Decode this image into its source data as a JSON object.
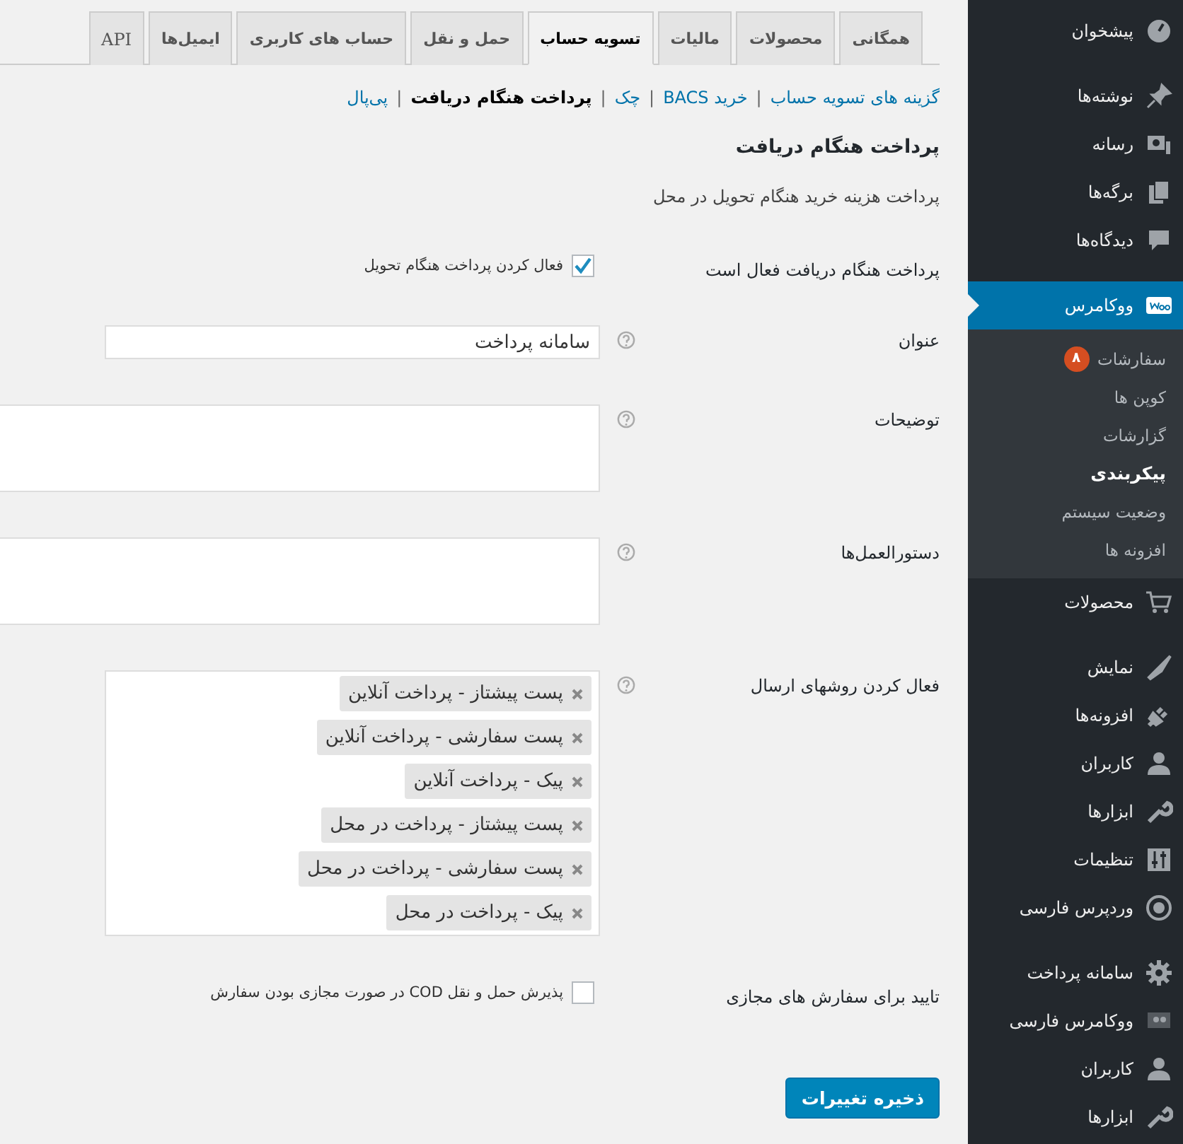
{
  "sidebar": {
    "groups": [
      [
        {
          "label": "پیشخوان",
          "selected": false
        }
      ],
      [
        {
          "label": "نوشته‌ها",
          "selected": false
        },
        {
          "label": "رسانه",
          "selected": false
        },
        {
          "label": "برگه‌ها",
          "selected": false
        },
        {
          "label": "دیدگاه‌ها",
          "selected": false
        }
      ],
      [
        {
          "label": "ووکامرس",
          "selected": true,
          "children": [
            {
              "label": "سفارشات",
              "selected": false,
              "badge": "۸"
            },
            {
              "label": "کوپن ها",
              "selected": false
            },
            {
              "label": "گزارشات",
              "selected": false
            },
            {
              "label": "پیکربندی",
              "selected": true
            },
            {
              "label": "وضعیت سیستم",
              "selected": false
            },
            {
              "label": "افزونه ها",
              "selected": false
            }
          ]
        },
        {
          "label": "محصولات",
          "selected": false
        }
      ],
      [
        {
          "label": "نمایش",
          "selected": false
        },
        {
          "label": "افزونه‌ها",
          "selected": false
        },
        {
          "label": "کاربران",
          "selected": false
        },
        {
          "label": "ابزارها",
          "selected": false
        },
        {
          "label": "تنظیمات",
          "selected": false
        },
        {
          "label": "وردپرس فارسی",
          "selected": false
        }
      ],
      [
        {
          "label": "سامانه پرداخت",
          "selected": false
        },
        {
          "label": "ووکامرس فارسی",
          "selected": false
        },
        {
          "label": "کاربران",
          "selected": false
        },
        {
          "label": "ابزارها",
          "selected": false
        }
      ]
    ]
  },
  "tabs": [
    {
      "label": "همگانی",
      "selected": false
    },
    {
      "label": "محصولات",
      "selected": false
    },
    {
      "label": "مالیات",
      "selected": false
    },
    {
      "label": "تسویه حساب",
      "selected": true
    },
    {
      "label": "حمل و نقل",
      "selected": false
    },
    {
      "label": "حساب های کاربری",
      "selected": false
    },
    {
      "label": "ایمیل‌ها",
      "selected": false
    },
    {
      "label": "API",
      "selected": false
    }
  ],
  "sections": [
    {
      "label": "گزینه های تسویه حساب",
      "selected": false
    },
    {
      "divider": "|",
      "label": "خرید BACS",
      "selected": false
    },
    {
      "divider": "|",
      "label": "چک",
      "selected": false
    },
    {
      "divider": "|",
      "label": "پرداخت هنگام دریافت",
      "selected": true
    },
    {
      "divider": "|",
      "label": "پی‌پال",
      "selected": false
    }
  ],
  "heading": "پرداخت هنگام دریافت",
  "description": "پرداخت هزینه خرید هنگام تحویل در محل",
  "fields": [
    {
      "kind": "checkbox",
      "label": "پرداخت هنگام دریافت فعال است",
      "checked": true,
      "text": "فعال کردن پرداخت هنگام تحویل"
    },
    {
      "kind": "text",
      "label": "عنوان",
      "value": "سامانه پرداخت"
    },
    {
      "kind": "textarea",
      "label": "توضیحات"
    },
    {
      "kind": "textarea",
      "label": "دستورالعمل‌ها"
    },
    {
      "kind": "multiselect",
      "label": "فعال کردن روشهای ارسال",
      "options": [
        "پست پیشتاز - پرداخت آنلاین",
        "پست سفارشی - پرداخت آنلاین",
        "پیک - پرداخت آنلاین",
        "پست پیشتاز - پرداخت در محل",
        "پست سفارشی - پرداخت در محل",
        "پیک - پرداخت در محل"
      ]
    },
    {
      "kind": "checkbox",
      "label": "تایید برای سفارش های مجازی",
      "checked": false,
      "text": "پذیرش حمل و نقل COD در صورت مجازی بودن سفارش"
    }
  ],
  "save_button": "ذخیره تغییرات"
}
